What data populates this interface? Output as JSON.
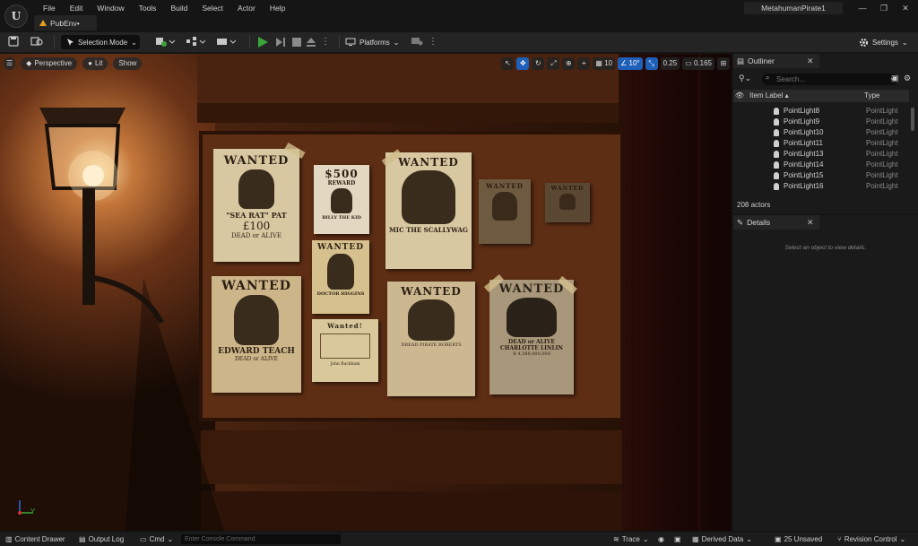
{
  "window": {
    "menu": [
      "File",
      "Edit",
      "Window",
      "Tools",
      "Build",
      "Select",
      "Actor",
      "Help"
    ],
    "tab_label": "PubEnv•",
    "project_name": "MetahumanPirate1",
    "minimize": "—",
    "maximize": "❐",
    "close": "✕"
  },
  "toolbar": {
    "selection_mode": "Selection Mode",
    "platforms": "Platforms",
    "settings": "Settings"
  },
  "viewport": {
    "view_mode": "Perspective",
    "lighting_mode": "Lit",
    "show": "Show",
    "grid_snap": "10",
    "rotation_snap": "10°",
    "scale_snap": "0.25",
    "camera_speed": "0.165",
    "axis_label": "Y"
  },
  "posters": {
    "p1_title": "WANTED",
    "p1_name": "\"SEA RAT\" PAT",
    "p1_amount": "£100",
    "p1_sub": "DEAD or ALIVE",
    "p2_title": "$500",
    "p2_sub": "REWARD",
    "p2_name": "BILLY THE KID",
    "p3_title": "WANTED",
    "p3_name": "MIC THE SCALLYWAG",
    "p4_title": "WANTED",
    "p4_name": "DOCTOR HIGGINS",
    "p5_title": "WANTED",
    "p5_name": "EDWARD TEACH",
    "p5_sub": "DEAD or ALIVE",
    "p6_title": "Wanted!",
    "p6_name": "John Buckham",
    "p7_title": "WANTED",
    "p7_name": "DREAD PIRATE ROBERTS",
    "p8_title": "WANTED",
    "p8_sub": "DEAD or ALIVE",
    "p8_name": "CHARLOTTE LINLIN",
    "p8_amount": "B 4,388,000,000",
    "p9_title": "WANTED",
    "p10_title": "WANTED"
  },
  "outliner": {
    "tab_label": "Outliner",
    "search_placeholder": "Search...",
    "col_label": "Item Label",
    "col_type": "Type",
    "rows": [
      {
        "label": "PointLight8",
        "type": "PointLight"
      },
      {
        "label": "PointLight9",
        "type": "PointLight"
      },
      {
        "label": "PointLight10",
        "type": "PointLight"
      },
      {
        "label": "PointLight11",
        "type": "PointLight"
      },
      {
        "label": "PointLight13",
        "type": "PointLight"
      },
      {
        "label": "PointLight14",
        "type": "PointLight"
      },
      {
        "label": "PointLight15",
        "type": "PointLight"
      },
      {
        "label": "PointLight16",
        "type": "PointLight"
      }
    ],
    "actor_count": "208 actors"
  },
  "details": {
    "tab_label": "Details",
    "empty_message": "Select an object to view details."
  },
  "statusbar": {
    "content_drawer": "Content Drawer",
    "output_log": "Output Log",
    "cmd": "Cmd",
    "console_placeholder": "Enter Console Command",
    "trace": "Trace",
    "derived_data": "Derived Data",
    "unsaved": "25 Unsaved",
    "revision_control": "Revision Control"
  },
  "colors": {
    "accent_blue": "#1e5fb8",
    "play_green": "#3aa53a",
    "tab_orange": "#e8a020"
  }
}
